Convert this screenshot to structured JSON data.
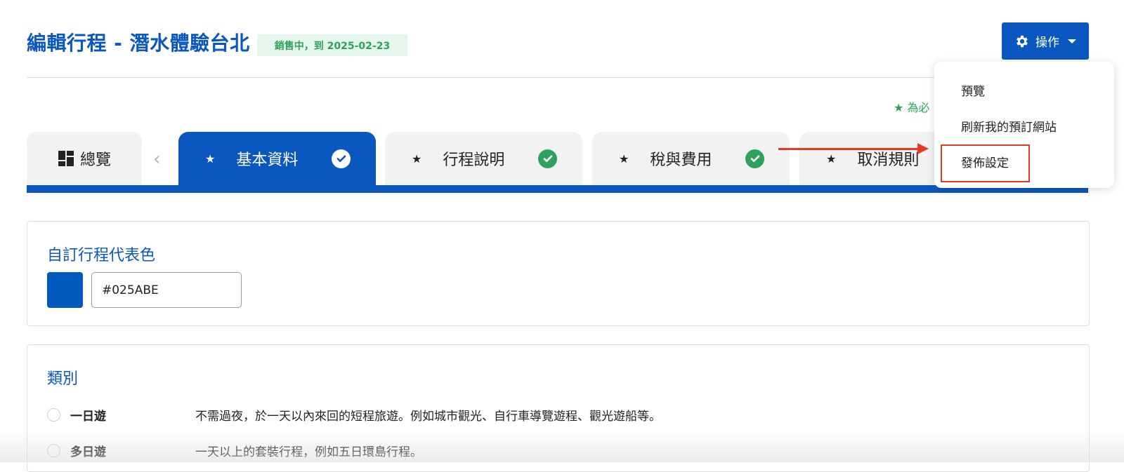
{
  "header": {
    "title": "編輯行程 - 潛水體驗台北",
    "status_badge": "銷售中，到 2025-02-23",
    "action_button": "操作",
    "required_note": "★ 為必"
  },
  "tabs": [
    {
      "label": "總覽"
    },
    {
      "label": "基本資料",
      "star": "★"
    },
    {
      "label": "行程說明",
      "star": "★"
    },
    {
      "label": "稅與費用",
      "star": "★"
    },
    {
      "label": "取消規則",
      "star": "★"
    }
  ],
  "dropdown": {
    "items": [
      "預覽",
      "刷新我的預訂網站",
      "發佈設定"
    ]
  },
  "color_section": {
    "title": "自訂行程代表色",
    "value": "#025ABE",
    "swatch_color": "#025abe"
  },
  "category_section": {
    "title": "類別",
    "options": [
      {
        "label": "一日遊",
        "desc": "不需過夜，於一天以內來回的短程旅遊。例如城市觀光、自行車導覽遊程、觀光遊船等。"
      },
      {
        "label": "多日遊",
        "desc": "一天以上的套裝行程，例如五日環島行程。"
      }
    ]
  },
  "colors": {
    "accent": "#0b57c0",
    "success": "#2ea25a",
    "highlight": "#e53b22"
  }
}
